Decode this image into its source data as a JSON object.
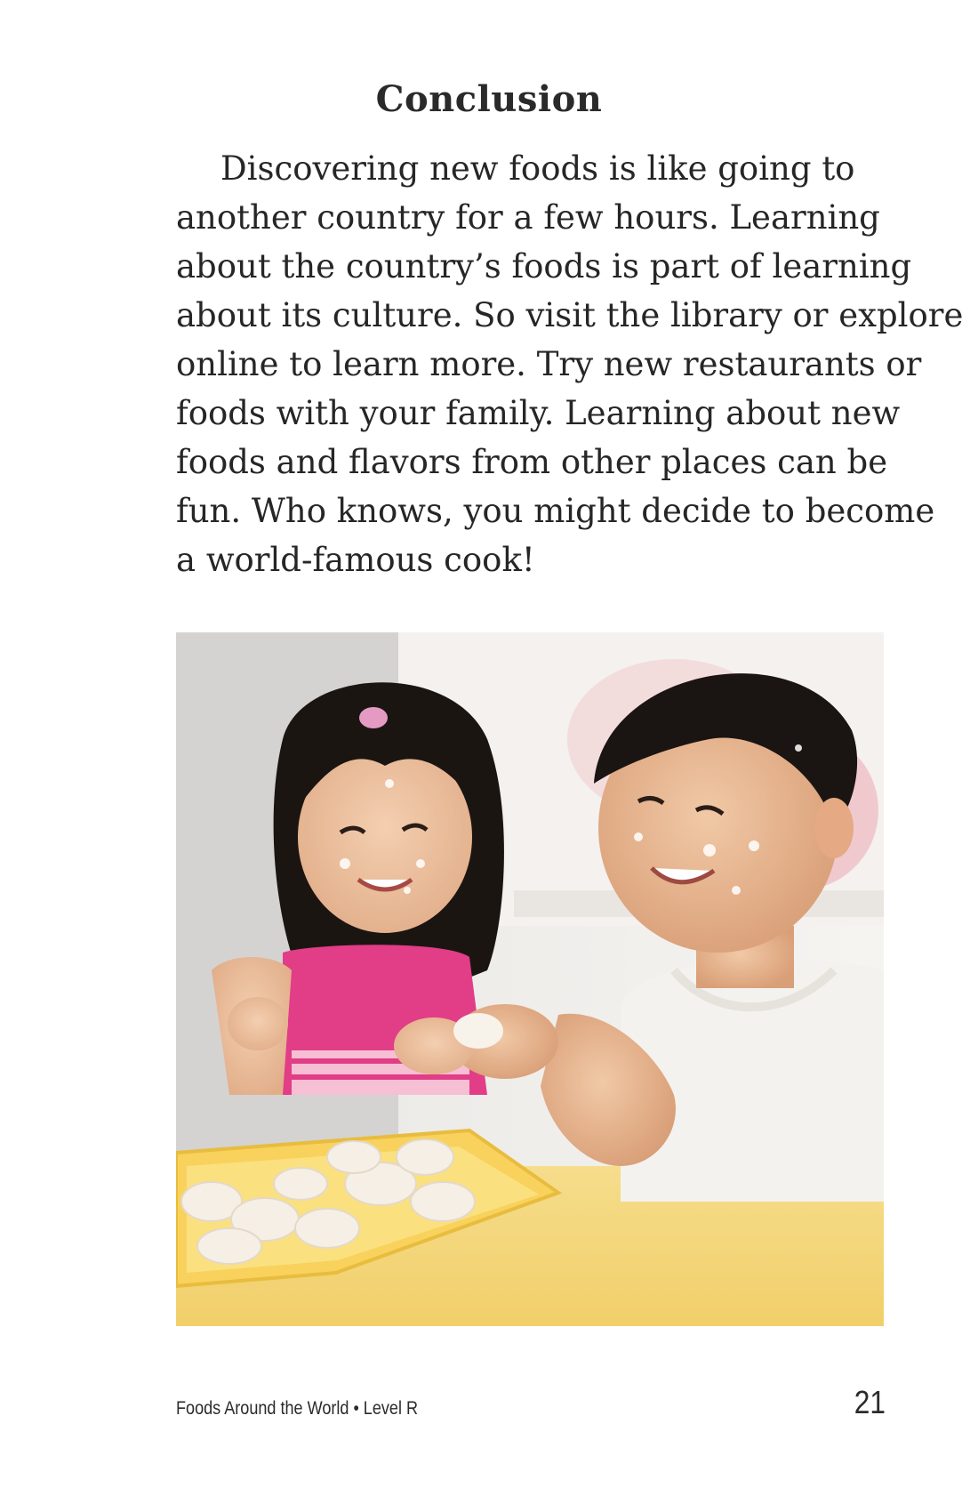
{
  "heading": "Conclusion",
  "paragraph_lines": [
    "Discovering new foods is like going to",
    "another country for a few hours. Learning",
    "about the country’s foods is part of learning",
    "about its culture. So visit the library or explore",
    "online to learn more. Try new restaurants or",
    "foods with your family. Learning about new",
    "foods and flavors from other places can be",
    "fun. Who knows, you might decide to become",
    "a world-famous cook!"
  ],
  "photo": {
    "icon": "photo-children-making-dumplings"
  },
  "footer": {
    "book_title": "Foods Around the World • Level R",
    "page_number": "21"
  }
}
